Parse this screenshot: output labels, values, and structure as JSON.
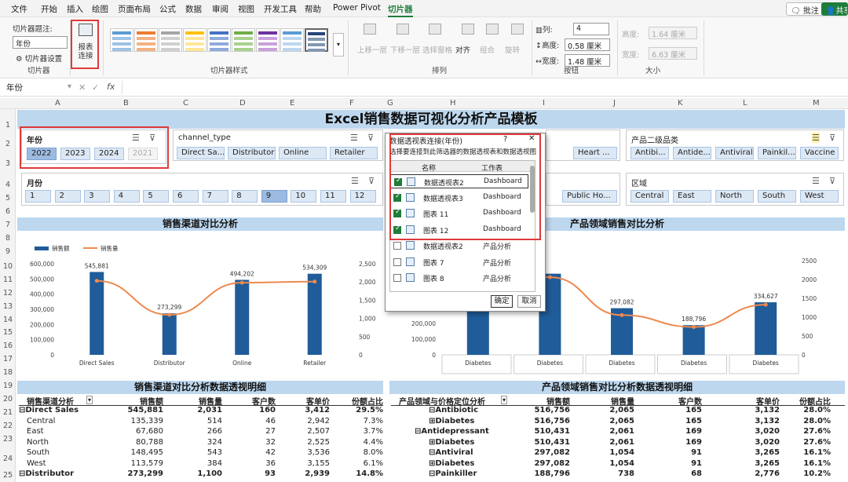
{
  "menu": {
    "tabs": [
      "文件",
      "开始",
      "插入",
      "绘图",
      "页面布局",
      "公式",
      "数据",
      "审阅",
      "视图",
      "开发工具",
      "帮助",
      "Power Pivot",
      "切片器"
    ],
    "comment_btn": "批注",
    "share_btn": "共享"
  },
  "ribbon": {
    "caption_label": "切片器题注:",
    "caption_value": "年份",
    "settings_label": "切片器设置",
    "group1": "切片器",
    "report_conn": "报表\n连接",
    "group2": "切片器样式",
    "arrange_items": [
      "上移一层",
      "下移一层",
      "选择窗格",
      "对齐",
      "组合",
      "旋转"
    ],
    "group3": "排列",
    "cols_label": "列:",
    "cols_value": "4",
    "height_label": "高度:",
    "height_value": "0.58 厘米",
    "width_label": "宽度:",
    "width_value": "1.48 厘米",
    "group4": "按钮",
    "size_h_label": "高度:",
    "size_h_value": "1.64 厘米",
    "size_w_label": "宽度:",
    "size_w_value": "6.63 厘米",
    "group5": "大小"
  },
  "formula": {
    "name_box": "年份",
    "fx": "fx"
  },
  "columns": [
    "A",
    "B",
    "C",
    "D",
    "E",
    "F",
    "G",
    "H",
    "I",
    "J",
    "K",
    "L",
    "M"
  ],
  "rows": [
    "1",
    "2",
    "3",
    "4",
    "5",
    "6",
    "7",
    "8",
    "9",
    "10",
    "11",
    "12",
    "13",
    "14",
    "15",
    "16",
    "17",
    "18",
    "19",
    "20",
    "21",
    "22",
    "23",
    "24",
    "25",
    "26",
    "27",
    "28",
    "29",
    "30",
    "31",
    "32"
  ],
  "title": "Excel销售数据可视化分析产品模板",
  "slicers": {
    "year": {
      "header": "年份",
      "items": [
        "2022",
        "2023",
        "2024",
        "2021"
      ]
    },
    "channel": {
      "header": "channel_type",
      "items": [
        "Direct Sa...",
        "Distributor",
        "Online",
        "Retailer"
      ]
    },
    "mid": {
      "items": [
        "Heart ..."
      ]
    },
    "sub": {
      "header": "产品二级品类",
      "items": [
        "Antibi...",
        "Antide...",
        "Antiviral",
        "Painkil...",
        "Vaccine"
      ]
    },
    "month": {
      "header": "月份",
      "items": [
        "1",
        "2",
        "3",
        "4",
        "5",
        "6",
        "7",
        "8",
        "9",
        "10",
        "11",
        "12"
      ]
    },
    "mid2": {
      "items": [
        "Public Ho..."
      ]
    },
    "region": {
      "header": "区域",
      "items": [
        "Central",
        "East",
        "North",
        "South",
        "West"
      ]
    }
  },
  "chart1": {
    "title": "销售渠道对比分析",
    "legend": [
      "销售额",
      "销售量"
    ]
  },
  "chart2": {
    "title": "产品领域销售对比分析"
  },
  "chart_data": [
    {
      "type": "bar",
      "title": "销售渠道对比分析",
      "categories": [
        "Direct Sales",
        "Distributor",
        "Online",
        "Retailer"
      ],
      "series": [
        {
          "name": "销售额",
          "values": [
            545881,
            273299,
            494202,
            534309
          ]
        },
        {
          "name": "销售量",
          "values": [
            2031,
            1100,
            1980,
            2010
          ]
        }
      ],
      "ylim": [
        0,
        600000
      ],
      "y2lim": [
        0,
        2500
      ],
      "yticks": [
        "600,000",
        "500,000",
        "400,000",
        "300,000",
        "200,000",
        "100,000",
        "0"
      ],
      "y2ticks": [
        "2,500",
        "2,000",
        "1,500",
        "1,000",
        "500",
        "0"
      ],
      "data_labels": [
        "545,881",
        "273,299",
        "494,202",
        "534,309"
      ]
    },
    {
      "type": "bar",
      "title": "产品领域销售对比分析",
      "categories": [
        "Diabetes",
        "Diabetes",
        "Diabetes",
        "Diabetes",
        "Diabetes"
      ],
      "series": [
        {
          "values": [
            510431,
            516756,
            297082,
            188796,
            334627
          ]
        },
        {
          "values": [
            2065,
            2061,
            1054,
            738,
            1330
          ]
        }
      ],
      "ylim": [
        0,
        600000
      ],
      "y2lim": [
        0,
        2500
      ],
      "yticks": [
        "200,000",
        "100,000",
        "0"
      ],
      "y2ticks": [
        "2500",
        "2000",
        "1500",
        "1000",
        "500",
        "0"
      ],
      "data_labels": [
        "510,431",
        "",
        "297,082",
        "188,796",
        "334,627"
      ]
    }
  ],
  "table1": {
    "title": "销售渠道对比分析数据透视明细",
    "headers": [
      "销售渠道分析",
      "销售额",
      "销售量",
      "客户数",
      "客单价",
      "份额占比"
    ],
    "rows": [
      [
        "⊟Direct Sales",
        "545,881",
        "2,031",
        "160",
        "3,412",
        "29.5%"
      ],
      [
        "Central",
        "135,339",
        "514",
        "46",
        "2,942",
        "7.3%"
      ],
      [
        "East",
        "67,680",
        "266",
        "27",
        "2,507",
        "3.7%"
      ],
      [
        "North",
        "80,788",
        "324",
        "32",
        "2,525",
        "4.4%"
      ],
      [
        "South",
        "148,495",
        "543",
        "42",
        "3,536",
        "8.0%"
      ],
      [
        "West",
        "113,579",
        "384",
        "36",
        "3,155",
        "6.1%"
      ],
      [
        "⊟Distributor",
        "273,299",
        "1,100",
        "93",
        "2,939",
        "14.8%"
      ]
    ]
  },
  "table2": {
    "title": "产品领域销售对比分析数据透视明细",
    "headers": [
      "产品领域与价格定位分析",
      "销售额",
      "销售量",
      "客户数",
      "客单价",
      "份额占比"
    ],
    "rows": [
      [
        "⊟Antibiotic",
        "516,756",
        "2,065",
        "165",
        "3,132",
        "28.0%"
      ],
      [
        "⊞Diabetes",
        "516,756",
        "2,065",
        "165",
        "3,132",
        "28.0%"
      ],
      [
        "⊟Antidepressant",
        "510,431",
        "2,061",
        "169",
        "3,020",
        "27.6%"
      ],
      [
        "⊞Diabetes",
        "510,431",
        "2,061",
        "169",
        "3,020",
        "27.6%"
      ],
      [
        "⊟Antiviral",
        "297,082",
        "1,054",
        "91",
        "3,265",
        "16.1%"
      ],
      [
        "⊞Diabetes",
        "297,082",
        "1,054",
        "91",
        "3,265",
        "16.1%"
      ],
      [
        "⊟Painkiller",
        "188,796",
        "738",
        "68",
        "2,776",
        "10.2%"
      ]
    ]
  },
  "dialog": {
    "title": "数据透视表连接(年份)",
    "help": "?",
    "close": "✕",
    "desc": "选择要连接到此筛选器的数据透视表和数据透视图",
    "col_name": "名称",
    "col_sheet": "工作表",
    "items": [
      {
        "name": "数据透视表2",
        "sheet": "Dashboard",
        "checked": true
      },
      {
        "name": "数据透视表3",
        "sheet": "Dashboard",
        "checked": true
      },
      {
        "name": "图表 11",
        "sheet": "Dashboard",
        "checked": true
      },
      {
        "name": "图表 12",
        "sheet": "Dashboard",
        "checked": true
      },
      {
        "name": "数据透视表2",
        "sheet": "产品分析",
        "checked": false
      },
      {
        "name": "图表 7",
        "sheet": "产品分析",
        "checked": false
      },
      {
        "name": "图表 8",
        "sheet": "产品分析",
        "checked": false
      }
    ],
    "ok": "确定",
    "cancel": "取消"
  },
  "colors": {
    "accent_green": "#1e7d3b",
    "bar": "#1f5c99",
    "line": "#ee8a4e",
    "header_blue": "#bdd7ee",
    "highlight_red": "#e03a3a"
  }
}
